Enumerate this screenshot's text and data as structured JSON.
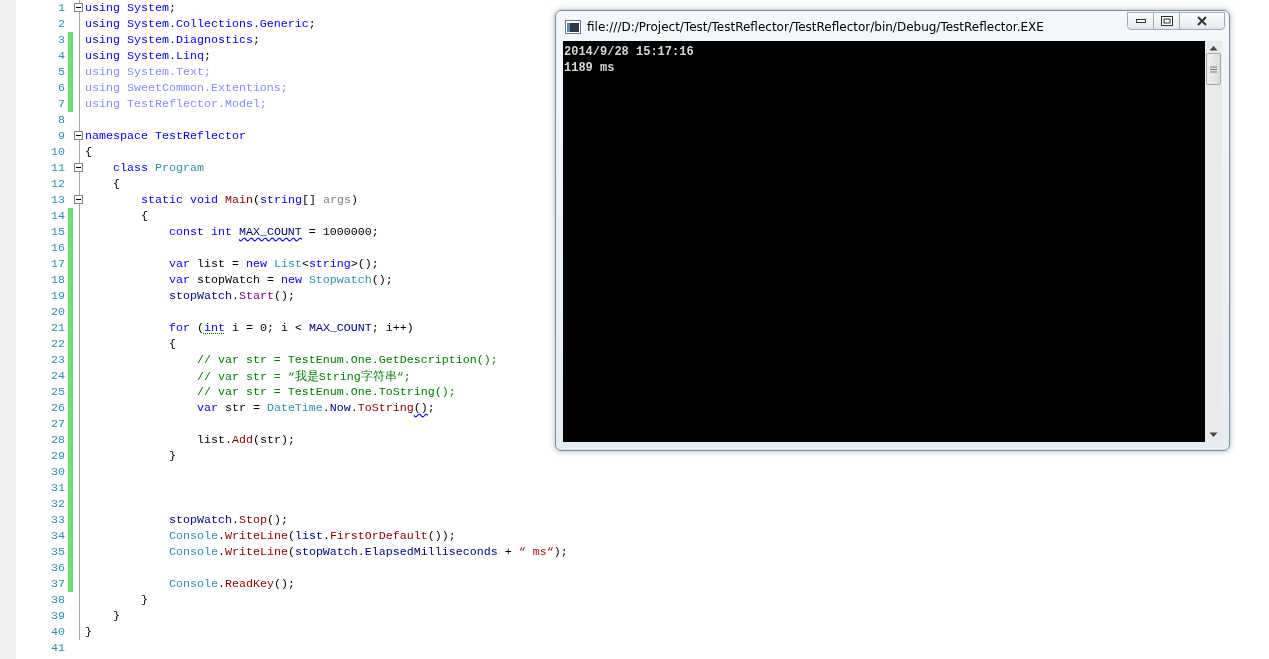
{
  "editor": {
    "lines": [
      {
        "number": "1",
        "changed": false,
        "fold": true,
        "tokens": [
          {
            "kind": "kw",
            "text": "using System"
          },
          {
            "kind": "plain",
            "text": ";"
          }
        ]
      },
      {
        "number": "2",
        "changed": false,
        "fold": false,
        "tokens": [
          {
            "kind": "kw",
            "text": "using System.Collections.Generic"
          },
          {
            "kind": "plain",
            "text": ";"
          }
        ]
      },
      {
        "number": "3",
        "changed": true,
        "fold": false,
        "tokens": [
          {
            "kind": "kw",
            "text": "using System.Diagnostics"
          },
          {
            "kind": "plain",
            "text": ";"
          }
        ]
      },
      {
        "number": "4",
        "changed": true,
        "fold": false,
        "tokens": [
          {
            "kind": "kw",
            "text": "using System.Linq"
          },
          {
            "kind": "plain",
            "text": ";"
          }
        ]
      },
      {
        "number": "5",
        "changed": true,
        "fold": false,
        "tokens": [
          {
            "kind": "faded",
            "text": "using System.Text;"
          }
        ]
      },
      {
        "number": "6",
        "changed": true,
        "fold": false,
        "tokens": [
          {
            "kind": "faded",
            "text": "using SweetCommon.Extentions;"
          }
        ]
      },
      {
        "number": "7",
        "changed": true,
        "fold": false,
        "tokens": [
          {
            "kind": "faded",
            "text": "using TestReflector.Model;"
          }
        ]
      },
      {
        "number": "8",
        "changed": false,
        "fold": false
      },
      {
        "number": "9",
        "changed": false,
        "fold": true,
        "tokens": [
          {
            "kind": "kw",
            "text": "namespace TestReflector"
          }
        ]
      },
      {
        "number": "10",
        "changed": false,
        "fold": false,
        "tokens": [
          {
            "kind": "plain",
            "text": "{"
          }
        ]
      },
      {
        "number": "11",
        "changed": false,
        "fold": true,
        "tokens": [
          {
            "kind": "kw",
            "text": "    class "
          },
          {
            "kind": "type",
            "text": "Program"
          }
        ]
      },
      {
        "number": "12",
        "changed": false,
        "fold": false,
        "tokens": [
          {
            "kind": "plain",
            "text": "    {"
          }
        ]
      },
      {
        "number": "13",
        "changed": false,
        "fold": true,
        "tokens": [
          {
            "kind": "kw",
            "text": "        static void "
          },
          {
            "kind": "method",
            "text": "Main"
          },
          {
            "kind": "plain",
            "text": "("
          },
          {
            "kind": "kw",
            "text": "string"
          },
          {
            "kind": "plain",
            "text": "[] "
          },
          {
            "kind": "param",
            "text": "args"
          },
          {
            "kind": "plain",
            "text": ")"
          }
        ]
      },
      {
        "number": "14",
        "changed": true,
        "fold": false,
        "tokens": [
          {
            "kind": "plain",
            "text": "        {"
          }
        ]
      },
      {
        "number": "15",
        "changed": true,
        "fold": false,
        "tokens": [
          {
            "kind": "kw",
            "text": "            const int "
          },
          {
            "kind": "ident",
            "text": "MAX_COUNT",
            "error_underline": true
          },
          {
            "kind": "plain",
            "text": " = 1000000;"
          }
        ]
      },
      {
        "number": "16",
        "changed": true,
        "fold": false
      },
      {
        "number": "17",
        "changed": true,
        "fold": false,
        "tokens": [
          {
            "kind": "kw",
            "text": "            var "
          },
          {
            "kind": "plain",
            "text": "list = "
          },
          {
            "kind": "kw",
            "text": "new "
          },
          {
            "kind": "type",
            "text": "List"
          },
          {
            "kind": "plain",
            "text": "<"
          },
          {
            "kind": "kw",
            "text": "string"
          },
          {
            "kind": "plain",
            "text": ">();"
          }
        ]
      },
      {
        "number": "18",
        "changed": true,
        "fold": false,
        "tokens": [
          {
            "kind": "kw",
            "text": "            var "
          },
          {
            "kind": "plain",
            "text": "stopWatch = "
          },
          {
            "kind": "kw",
            "text": "new "
          },
          {
            "kind": "type",
            "text": "Stopwatch"
          },
          {
            "kind": "plain",
            "text": "();"
          }
        ]
      },
      {
        "number": "19",
        "changed": true,
        "fold": false,
        "tokens": [
          {
            "kind": "ident",
            "text": "            stopWatch"
          },
          {
            "kind": "plain",
            "text": "."
          },
          {
            "kind": "ext",
            "text": "Start"
          },
          {
            "kind": "plain",
            "text": "();"
          }
        ]
      },
      {
        "number": "20",
        "changed": true,
        "fold": false
      },
      {
        "number": "21",
        "changed": true,
        "fold": false,
        "tokens": [
          {
            "kind": "kw",
            "text": "            for "
          },
          {
            "kind": "plain",
            "text": "("
          },
          {
            "kind": "kw",
            "text": "int",
            "warning_underline": true
          },
          {
            "kind": "plain",
            "text": " i = 0; i < "
          },
          {
            "kind": "ident",
            "text": "MAX_COUNT"
          },
          {
            "kind": "plain",
            "text": "; i++)"
          }
        ]
      },
      {
        "number": "22",
        "changed": true,
        "fold": false,
        "tokens": [
          {
            "kind": "plain",
            "text": "            {"
          }
        ]
      },
      {
        "number": "23",
        "changed": true,
        "fold": false,
        "tokens": [
          {
            "kind": "comment",
            "text": "                // var str = TestEnum.One.GetDescription();"
          }
        ]
      },
      {
        "number": "24",
        "changed": true,
        "fold": false,
        "tokens": [
          {
            "kind": "comment",
            "text": "                // var str = “我是String字符串“;"
          }
        ]
      },
      {
        "number": "25",
        "changed": true,
        "fold": false,
        "tokens": [
          {
            "kind": "comment",
            "text": "                // var str = TestEnum.One.ToString();"
          }
        ]
      },
      {
        "number": "26",
        "changed": true,
        "fold": false,
        "tokens": [
          {
            "kind": "kw",
            "text": "                var "
          },
          {
            "kind": "plain",
            "text": "str = "
          },
          {
            "kind": "type",
            "text": "DateTime"
          },
          {
            "kind": "plain",
            "text": "."
          },
          {
            "kind": "ident",
            "text": "Now"
          },
          {
            "kind": "plain",
            "text": "."
          },
          {
            "kind": "method",
            "text": "ToString"
          },
          {
            "kind": "plain",
            "text": "()",
            "error_underline": true
          },
          {
            "kind": "plain",
            "text": ";"
          }
        ]
      },
      {
        "number": "27",
        "changed": true,
        "fold": false
      },
      {
        "number": "28",
        "changed": true,
        "fold": false,
        "tokens": [
          {
            "kind": "plain",
            "text": "                list."
          },
          {
            "kind": "method",
            "text": "Add"
          },
          {
            "kind": "plain",
            "text": "(str);"
          }
        ]
      },
      {
        "number": "29",
        "changed": true,
        "fold": false,
        "tokens": [
          {
            "kind": "plain",
            "text": "            }"
          }
        ]
      },
      {
        "number": "30",
        "changed": true,
        "fold": false
      },
      {
        "number": "31",
        "changed": true,
        "fold": false
      },
      {
        "number": "32",
        "changed": true,
        "fold": false
      },
      {
        "number": "33",
        "changed": true,
        "fold": false,
        "tokens": [
          {
            "kind": "ident",
            "text": "            stopWatch"
          },
          {
            "kind": "plain",
            "text": "."
          },
          {
            "kind": "method",
            "text": "Stop"
          },
          {
            "kind": "plain",
            "text": "();"
          }
        ]
      },
      {
        "number": "34",
        "changed": true,
        "fold": false,
        "tokens": [
          {
            "kind": "type",
            "text": "            Console"
          },
          {
            "kind": "plain",
            "text": "."
          },
          {
            "kind": "method",
            "text": "WriteLine"
          },
          {
            "kind": "plain",
            "text": "("
          },
          {
            "kind": "ident",
            "text": "list"
          },
          {
            "kind": "plain",
            "text": "."
          },
          {
            "kind": "method",
            "text": "FirstOrDefault"
          },
          {
            "kind": "plain",
            "text": "());"
          }
        ]
      },
      {
        "number": "35",
        "changed": true,
        "fold": false,
        "tokens": [
          {
            "kind": "type",
            "text": "            Console"
          },
          {
            "kind": "plain",
            "text": "."
          },
          {
            "kind": "method",
            "text": "WriteLine"
          },
          {
            "kind": "plain",
            "text": "("
          },
          {
            "kind": "ident",
            "text": "stopWatch"
          },
          {
            "kind": "plain",
            "text": "."
          },
          {
            "kind": "ident",
            "text": "ElapsedMilliseconds"
          },
          {
            "kind": "plain",
            "text": " + "
          },
          {
            "kind": "string",
            "text": "“ ms“"
          },
          {
            "kind": "plain",
            "text": ");"
          }
        ]
      },
      {
        "number": "36",
        "changed": true,
        "fold": false
      },
      {
        "number": "37",
        "changed": true,
        "fold": false,
        "tokens": [
          {
            "kind": "type",
            "text": "            Console"
          },
          {
            "kind": "plain",
            "text": "."
          },
          {
            "kind": "method",
            "text": "ReadKey"
          },
          {
            "kind": "plain",
            "text": "();"
          }
        ]
      },
      {
        "number": "38",
        "changed": false,
        "fold": false,
        "tokens": [
          {
            "kind": "plain",
            "text": "        }"
          }
        ]
      },
      {
        "number": "39",
        "changed": false,
        "fold": false,
        "tokens": [
          {
            "kind": "plain",
            "text": "    }"
          }
        ]
      },
      {
        "number": "40",
        "changed": false,
        "fold": false,
        "tokens": [
          {
            "kind": "plain",
            "text": "}"
          }
        ]
      },
      {
        "number": "41",
        "changed": false,
        "fold": false
      }
    ]
  },
  "console_window": {
    "title": "file:///D:/Project/Test/TestReflector/TestReflector/bin/Debug/TestReflector.EXE",
    "output": [
      "2014/9/28 15:17:16",
      "1189 ms"
    ]
  }
}
